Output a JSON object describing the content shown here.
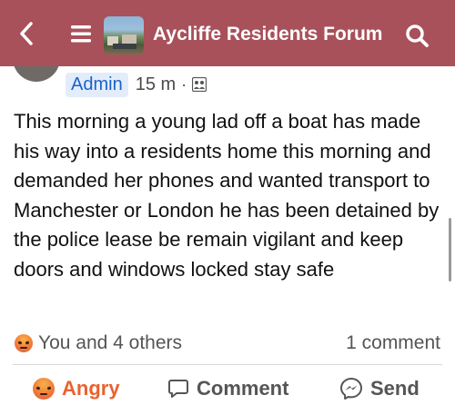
{
  "header": {
    "title": "Aycliffe Residents Forum",
    "back_icon": "chevron-left-icon",
    "menu_icon": "hamburger-menu-icon",
    "search_icon": "search-icon",
    "color": "#a8515a"
  },
  "post": {
    "author_badge": "Admin",
    "time": "15 m",
    "separator": "·",
    "audience_icon": "group-audience-icon",
    "text": "This morning a young lad off a boat has made his way into a residents home this morning and demanded her phones and wanted transport to Manchester or London he has been detained by the police lease be remain vigilant and keep doors and windows locked stay safe"
  },
  "engagement": {
    "reaction_icon": "angry-emoji-icon",
    "reactions": "You and 4 others",
    "comments": "1 comment"
  },
  "actions": {
    "angry": "Angry",
    "comment": "Comment",
    "send": "Send",
    "angry_color": "#e8632f"
  }
}
